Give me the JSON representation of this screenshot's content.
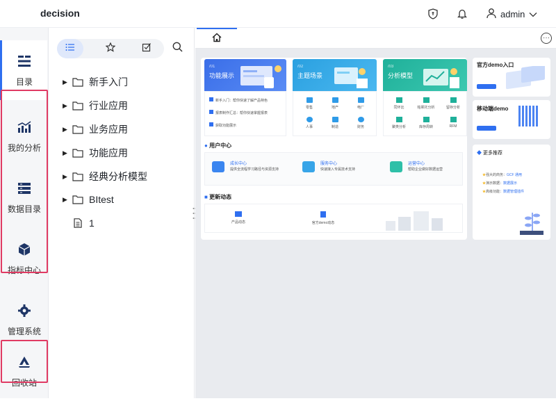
{
  "header": {
    "app_name": "decision",
    "user_name": "admin",
    "icons": [
      "shield-icon",
      "bell-icon",
      "user-icon",
      "chevron-down-icon"
    ]
  },
  "rail": {
    "items": [
      {
        "label": "目录",
        "icon": "catalog-icon",
        "active": true
      },
      {
        "label": "我的分析",
        "icon": "analysis-icon"
      },
      {
        "label": "数据目录",
        "icon": "data-catalog-icon"
      },
      {
        "label": "指标中心",
        "icon": "metric-cube-icon"
      },
      {
        "label": "管理系统",
        "icon": "gear-icon"
      },
      {
        "label": "回收站",
        "icon": "recycle-icon"
      }
    ],
    "highlight_color": "#e03a63",
    "accent_color": "#2f6ff0"
  },
  "catalog": {
    "tabs": [
      "list-icon",
      "star-icon",
      "edit-check-icon"
    ],
    "tree": [
      {
        "label": "新手入门",
        "type": "folder"
      },
      {
        "label": "行业应用",
        "type": "folder"
      },
      {
        "label": "业务应用",
        "type": "folder"
      },
      {
        "label": "功能应用",
        "type": "folder"
      },
      {
        "label": "经典分析模型",
        "type": "folder"
      },
      {
        "label": "BItest",
        "type": "folder"
      },
      {
        "label": "1",
        "type": "document"
      }
    ]
  },
  "dashboard": {
    "feature_cards": [
      {
        "num": "/01",
        "title": "功能展示",
        "rows": [
          "新手入门：帮你快速了解产品特色",
          "报表制作汇总：帮你快速掌握报表",
          "获取功能展示"
        ]
      },
      {
        "num": "/02",
        "title": "主题场景",
        "items": [
          "零售",
          "地产",
          "电厂",
          "人事",
          "制造",
          "财务"
        ]
      },
      {
        "num": "/03",
        "title": "分析模型",
        "items": [
          "同环比",
          "帕累托分析",
          "留存分析",
          "聚类分析",
          "库存周转",
          "RFM"
        ]
      }
    ],
    "user_center": {
      "title": "用户中心",
      "items": [
        {
          "title": "成长中心",
          "desc": "提供全流程学习路径与资源支持"
        },
        {
          "title": "服务中心",
          "desc": "快速接入专属技术支持"
        },
        {
          "title": "运营中心",
          "desc": "帮助企业做好数据运营"
        }
      ]
    },
    "updates": {
      "title": "更新动态",
      "items": [
        "产品动态",
        "官方demo动态"
      ]
    },
    "side": {
      "demo_title": "官方demo入口",
      "mobile_title": "移动端demo",
      "recommend_title": "更多推荐",
      "recommend": [
        {
          "label": "强大的商务：",
          "link": "GCF 通用"
        },
        {
          "label": "演示数据：",
          "link": "数据展示"
        },
        {
          "label": "高级功能：",
          "link": "数据管理插件"
        }
      ]
    }
  }
}
